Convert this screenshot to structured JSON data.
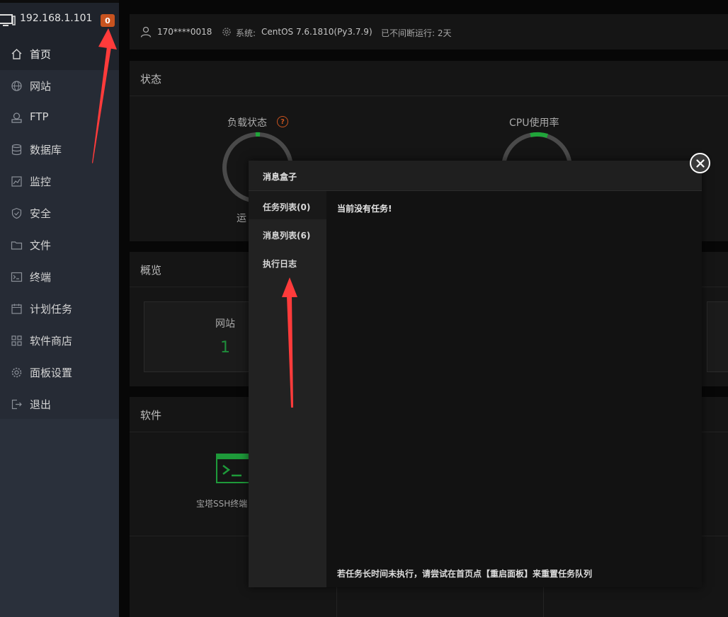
{
  "sidebar": {
    "host_ip": "192.168.1.101",
    "badge_count": "0",
    "items": [
      {
        "label": "首页",
        "icon": "home-icon"
      },
      {
        "label": "网站",
        "icon": "globe-icon"
      },
      {
        "label": "FTP",
        "icon": "ftp-icon"
      },
      {
        "label": "数据库",
        "icon": "database-icon"
      },
      {
        "label": "监控",
        "icon": "monitor-icon"
      },
      {
        "label": "安全",
        "icon": "shield-icon"
      },
      {
        "label": "文件",
        "icon": "folder-icon"
      },
      {
        "label": "终端",
        "icon": "terminal-icon"
      },
      {
        "label": "计划任务",
        "icon": "calendar-icon"
      },
      {
        "label": "软件商店",
        "icon": "apps-icon"
      },
      {
        "label": "面板设置",
        "icon": "gear-icon"
      },
      {
        "label": "退出",
        "icon": "logout-icon"
      }
    ]
  },
  "topbar": {
    "user": "170****0018",
    "system_label": "系统:",
    "system_value": "CentOS 7.6.1810(Py3.7.9)",
    "uptime": "已不间断运行: 2天"
  },
  "status": {
    "title": "状态",
    "load_title": "负载状态",
    "cpu_title": "CPU使用率",
    "running_text": "运"
  },
  "overview": {
    "title": "概览",
    "site_label": "网站",
    "site_count": "1"
  },
  "software": {
    "title": "软件",
    "ssh_label": "宝塔SSH终端"
  },
  "modal": {
    "title": "消息盒子",
    "tabs": [
      "任务列表(0)",
      "消息列表(6)",
      "执行日志"
    ],
    "empty_message": "当前没有任务!",
    "hint": "若任务长时间未执行，请尝试在首页点【重启面板】来重置任务队列"
  },
  "colors": {
    "accent_green": "#20a53a",
    "badge_orange": "#c8531f",
    "arrow_red": "#ff3b3b"
  }
}
